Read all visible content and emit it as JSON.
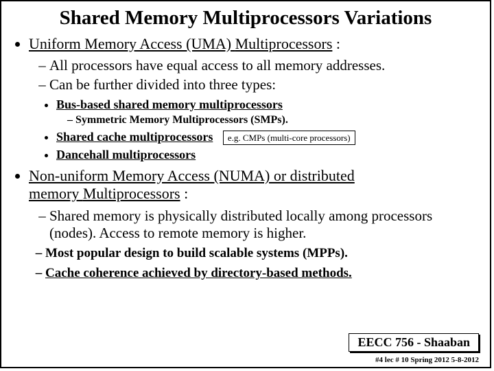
{
  "title": "Shared Memory Multiprocessors Variations",
  "sec1": {
    "heading_prefix": "Uniform Memory Access (UMA) ",
    "heading_word": "Multiprocessors",
    "heading_suffix": " :",
    "p1": "All processors have equal access to all memory addresses.",
    "p2": "Can be further divided into three types:",
    "b1": "Bus-based shared memory multiprocessors",
    "b1a": "Symmetric Memory Multiprocessors (SMPs).",
    "b2": "Shared cache multiprocessors",
    "b2_note": "e.g. CMPs (multi-core processors)",
    "b3": "Dancehall multiprocessors"
  },
  "sec2": {
    "heading_line1": "Non-uniform Memory Access (NUMA) or distributed",
    "heading_line2a": "memory ",
    "heading_line2b": "Multiprocessors",
    "heading_line2c": " :",
    "p1": "Shared memory is physically distributed locally among processors (nodes).  Access to remote memory is higher.",
    "p2": "Most popular design to build scalable systems (MPPs).",
    "p3": "Cache coherence achieved by directory-based methods."
  },
  "footer": {
    "course": "EECC 756 - Shaaban",
    "meta": "#4  lec # 10    Spring 2012   5-8-2012"
  }
}
